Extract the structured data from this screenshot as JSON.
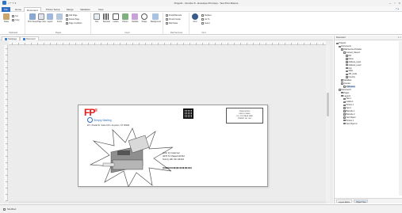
{
  "window": {
    "title": "Project1 - Number 8 - Envelope Print App - Test Print Macros",
    "controls": [
      "–",
      "▫",
      "×"
    ]
  },
  "menubar": {
    "tabs": [
      "File",
      "Home",
      "Document",
      "Printer Setup",
      "Merge",
      "Validation",
      "View"
    ],
    "active": "Document"
  },
  "ribbon": {
    "groups": [
      {
        "label": "Clipboard",
        "buttons": [
          "Paste",
          "Cut",
          "Copy"
        ]
      },
      {
        "label": "Pages",
        "buttons": [
          "Print Setup",
          "Page Size",
          "Layers",
          "Fonts"
        ],
        "small": [
          "Add Page",
          "Delete Page",
          "Page Condition"
        ]
      },
      {
        "label": "Insert",
        "buttons": [
          "Text",
          "Barcode",
          "Indicia",
          "Picture",
          "Variable",
          "Shape",
          "Background"
        ]
      },
      {
        "label": "Mail Services",
        "small": [
          "Postal Barcode",
          "Presort Guide",
          "Mail Class"
        ]
      },
      {
        "label": "Find",
        "buttons": [
          "Find"
        ],
        "small": [
          "Replace",
          "Go To",
          "Select"
        ]
      }
    ]
  },
  "doc_tabs": [
    "Startpage",
    "Document"
  ],
  "envelope": {
    "brand": "FP",
    "brand_mark": "®",
    "slogan": "Simply Mailing",
    "return_address": "FP • Postal St. Suite 100 • Anytown, ST 00000",
    "stamp": [
      "PRESORTED",
      "FIRST-CLASS",
      "U.S. POSTAGE PAID",
      "PERMIT NO. 000"
    ],
    "recipient": [
      "John Q Customer",
      "4270 N Chapel Hill Rd",
      "Sunny Hill, OH 44124"
    ],
    "barcode": "ⅠⅡⅠⅡⅡⅠⅠⅡⅠⅠⅡⅡⅠⅡⅠⅠⅡⅠⅡⅡⅠⅡⅠⅠⅡⅠⅡ"
  },
  "panel": {
    "title": "Document",
    "tree": [
      {
        "label": "Project1",
        "depth": 0,
        "icon": "folder"
      },
      {
        "label": "Document1",
        "depth": 1,
        "icon": "doc"
      },
      {
        "label": "Mail Service Provider",
        "depth": 2,
        "icon": "folder"
      },
      {
        "label": "Content_Sheet1",
        "depth": 3,
        "icon": "doc"
      },
      {
        "label": "ID1",
        "depth": 4,
        "icon": "field"
      },
      {
        "label": "Name",
        "depth": 4,
        "icon": "field"
      },
      {
        "label": "Address_Line1",
        "depth": 4,
        "icon": "field"
      },
      {
        "label": "Address_Line2",
        "depth": 4,
        "icon": "field"
      },
      {
        "label": "City",
        "depth": 4,
        "icon": "field"
      },
      {
        "label": "State",
        "depth": 4,
        "icon": "field"
      },
      {
        "label": "ZIP_Code",
        "depth": 4,
        "icon": "field"
      },
      {
        "label": "Country",
        "depth": 4,
        "icon": "field"
      },
      {
        "label": "Variables",
        "depth": 2,
        "icon": "folder"
      },
      {
        "label": "Queries",
        "depth": 2,
        "icon": "folder"
      },
      {
        "label": "Addresses",
        "depth": 3,
        "icon": "doc",
        "selected": true
      },
      {
        "label": "Document1",
        "depth": 1,
        "icon": "doc"
      },
      {
        "label": "Pages",
        "depth": 2,
        "icon": "folder"
      },
      {
        "label": "Layout1",
        "depth": 2,
        "icon": "folder"
      },
      {
        "label": "Text 1",
        "depth": 3,
        "icon": "field"
      },
      {
        "label": "Indicia 1",
        "depth": 3,
        "icon": "field"
      },
      {
        "label": "Picture 1",
        "depth": 3,
        "icon": "field"
      },
      {
        "label": "Text 2",
        "depth": 3,
        "icon": "field"
      },
      {
        "label": "Barcode 1",
        "depth": 3,
        "icon": "field"
      },
      {
        "label": "Barcode 2",
        "depth": 3,
        "icon": "field"
      },
      {
        "label": "Text Object",
        "depth": 3,
        "icon": "field"
      },
      {
        "label": "Picture 2",
        "depth": 3,
        "icon": "field"
      },
      {
        "label": "Text Object 2",
        "depth": 3,
        "icon": "field"
      }
    ],
    "footer_tabs": [
      "Layout Editor",
      "Object Tree"
    ],
    "footer_active": "Object Tree"
  },
  "status": {
    "text": "Modified"
  },
  "colors": {
    "accent": "#2e6dbf",
    "brand_red": "#e41a1c"
  }
}
